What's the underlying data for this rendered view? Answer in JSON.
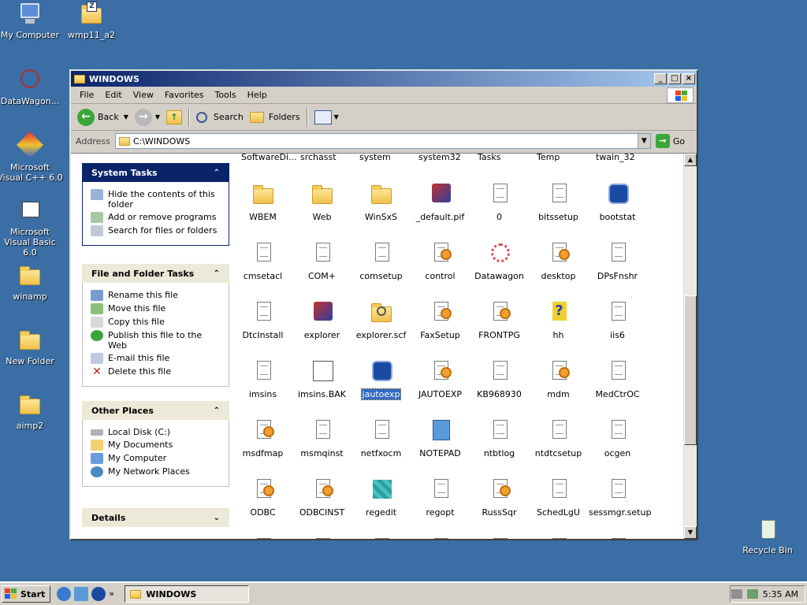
{
  "desktop": {
    "icons": [
      {
        "label": "My Computer"
      },
      {
        "label": "wmp11_a2"
      },
      {
        "label": "DataWagon..."
      },
      {
        "label": "Microsoft Visual C++ 6.0"
      },
      {
        "label": "Microsoft Visual Basic 6.0"
      },
      {
        "label": "winamp"
      },
      {
        "label": "New Folder"
      },
      {
        "label": "aimp2"
      },
      {
        "label": "Recycle Bin"
      }
    ]
  },
  "window": {
    "title": "WINDOWS",
    "menu": [
      "File",
      "Edit",
      "View",
      "Favorites",
      "Tools",
      "Help"
    ],
    "toolbar": {
      "back": "Back",
      "search": "Search",
      "folders": "Folders"
    },
    "address": {
      "label": "Address",
      "value": "C:\\WINDOWS",
      "go": "Go"
    }
  },
  "taskpane": {
    "system_tasks": {
      "title": "System Tasks",
      "items": [
        "Hide the contents of this folder",
        "Add or remove programs",
        "Search for files or folders"
      ]
    },
    "file_folder_tasks": {
      "title": "File and Folder Tasks",
      "items": [
        "Rename this file",
        "Move this file",
        "Copy this file",
        "Publish this file to the Web",
        "E-mail this file",
        "Delete this file"
      ]
    },
    "other_places": {
      "title": "Other Places",
      "items": [
        "Local Disk (C:)",
        "My Documents",
        "My Computer",
        "My Network Places"
      ]
    },
    "details": {
      "title": "Details"
    }
  },
  "files": {
    "cut_row": [
      "SoftwareDi...",
      "srchasst",
      "system",
      "system32",
      "Tasks",
      "Temp",
      "twain_32"
    ],
    "items": [
      "WBEM",
      "Web",
      "WinSxS",
      "_default.pif",
      "0",
      "bitssetup",
      "bootstat",
      "cmsetacl",
      "COM+",
      "comsetup",
      "control",
      "Datawagon",
      "desktop",
      "DPsFnshr",
      "DtcInstall",
      "explorer",
      "explorer.scf",
      "FaxSetup",
      "FRONTPG",
      "hh",
      "iis6",
      "imsins",
      "imsins.BAK",
      "jautoexp",
      "JAUTOEXP",
      "KB968930",
      "mdm",
      "MedCtrOC",
      "msdfmap",
      "msmqinst",
      "netfxocm",
      "NOTEPAD",
      "ntbtlog",
      "ntdtcsetup",
      "ocgen",
      "ODBC",
      "ODBCINST",
      "regedit",
      "regopt",
      "RussSqr",
      "SchedLgU",
      "sessmgr.setup"
    ],
    "selected": "jautoexp"
  },
  "taskbar": {
    "start": "Start",
    "task_button": "WINDOWS",
    "clock": "5:35 AM"
  }
}
